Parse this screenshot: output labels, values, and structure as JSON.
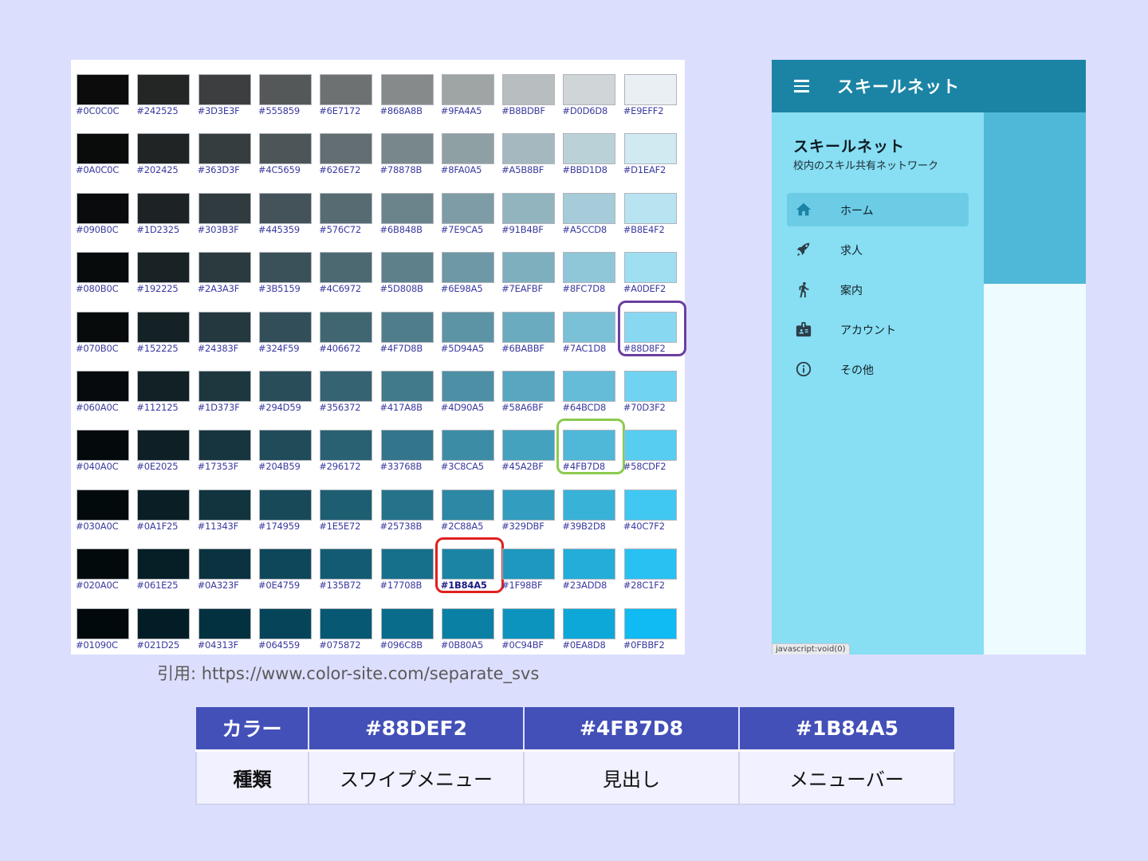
{
  "palette": {
    "rows": [
      [
        "#0C0C0C",
        "#242525",
        "#3D3E3F",
        "#555859",
        "#6E7172",
        "#868A8B",
        "#9FA4A5",
        "#B8BDBF",
        "#D0D6D8",
        "#E9EFF2"
      ],
      [
        "#0A0C0C",
        "#202425",
        "#363D3F",
        "#4C5659",
        "#626E72",
        "#78878B",
        "#8FA0A5",
        "#A5B8BF",
        "#BBD1D8",
        "#D1EAF2"
      ],
      [
        "#090B0C",
        "#1D2325",
        "#303B3F",
        "#445359",
        "#576C72",
        "#6B848B",
        "#7E9CA5",
        "#91B4BF",
        "#A5CCD8",
        "#B8E4F2"
      ],
      [
        "#080B0C",
        "#192225",
        "#2A3A3F",
        "#3B5159",
        "#4C6972",
        "#5D808B",
        "#6E98A5",
        "#7EAFBF",
        "#8FC7D8",
        "#A0DEF2"
      ],
      [
        "#070B0C",
        "#152225",
        "#24383F",
        "#324F59",
        "#406672",
        "#4F7D8B",
        "#5D94A5",
        "#6BABBF",
        "#7AC1D8",
        "#88D8F2"
      ],
      [
        "#060A0C",
        "#112125",
        "#1D373F",
        "#294D59",
        "#356372",
        "#417A8B",
        "#4D90A5",
        "#58A6BF",
        "#64BCD8",
        "#70D3F2"
      ],
      [
        "#040A0C",
        "#0E2025",
        "#17353F",
        "#204B59",
        "#296172",
        "#33768B",
        "#3C8CA5",
        "#45A2BF",
        "#4FB7D8",
        "#58CDF2"
      ],
      [
        "#030A0C",
        "#0A1F25",
        "#11343F",
        "#174959",
        "#1E5E72",
        "#25738B",
        "#2C88A5",
        "#329DBF",
        "#39B2D8",
        "#40C7F2"
      ],
      [
        "#020A0C",
        "#061E25",
        "#0A323F",
        "#0E4759",
        "#135B72",
        "#17708B",
        "#1B84A5",
        "#1F98BF",
        "#23ADD8",
        "#28C1F2"
      ],
      [
        "#01090C",
        "#021D25",
        "#04313F",
        "#064559",
        "#075872",
        "#096C8B",
        "#0B80A5",
        "#0C94BF",
        "#0EA8D8",
        "#0FBBF2"
      ]
    ],
    "emphasized_code": "#1B84A5",
    "highlights": [
      {
        "code": "#88D8F2",
        "color": "#6B3FA0"
      },
      {
        "code": "#4FB7D8",
        "color": "#8CCB4E"
      },
      {
        "code": "#1B84A5",
        "color": "#E02020"
      }
    ]
  },
  "app": {
    "title": "スキールネット",
    "drawer_title": "スキールネット",
    "drawer_subtitle": "校内のスキル共有ネットワーク",
    "nav": [
      {
        "label": "ホーム",
        "icon": "home-icon",
        "active": true
      },
      {
        "label": "求人",
        "icon": "rocket-icon",
        "active": false
      },
      {
        "label": "案内",
        "icon": "person-walking-icon",
        "active": false
      },
      {
        "label": "アカウント",
        "icon": "badge-icon",
        "active": false
      },
      {
        "label": "その他",
        "icon": "info-icon",
        "active": false
      }
    ],
    "status_url": "javascript:void(0)",
    "colors": {
      "appbar": "#1B84A5",
      "drawer": "#88DEF2",
      "header": "#4FB7D8",
      "content": "#EEFBFF"
    }
  },
  "citation": "引用: https://www.color-site.com/separate_svs",
  "table": {
    "header": [
      "カラー",
      "#88DEF2",
      "#4FB7D8",
      "#1B84A5"
    ],
    "row": [
      "種類",
      "スワイプメニュー",
      "見出し",
      "メニューバー"
    ]
  }
}
